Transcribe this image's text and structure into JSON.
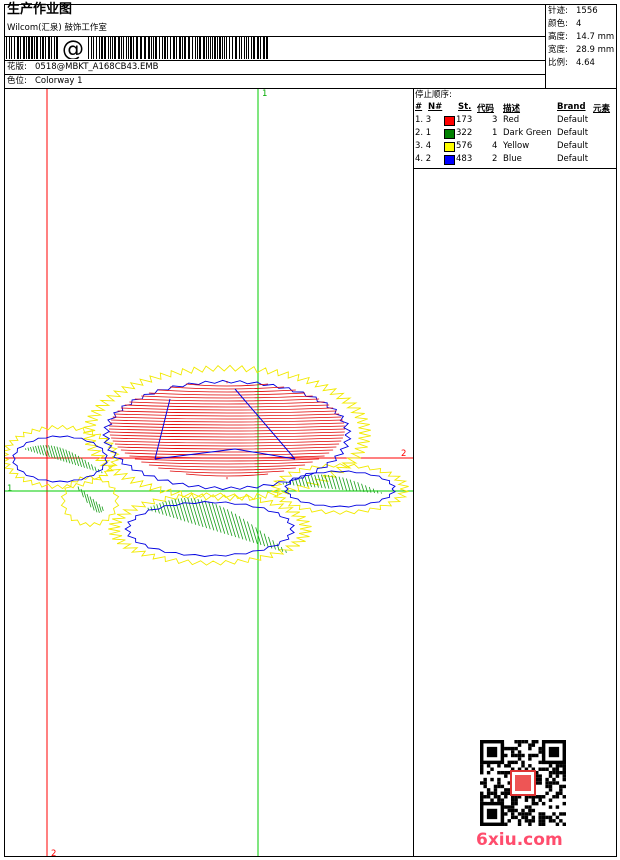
{
  "header": {
    "title": "生产作业图",
    "studio": "Wilcom(汇泉) 鼓饰工作室",
    "design_label": "花版:",
    "design_value": "0518@MBKT_A168CB43.EMB",
    "colorway_label": "色位:",
    "colorway_value": "Colorway 1"
  },
  "stats": {
    "stitches_label": "针迹:",
    "stitches_value": "1556",
    "colors_label": "颜色:",
    "colors_value": "4",
    "height_label": "高度:",
    "height_value": "14.7 mm",
    "width_label": "宽度:",
    "width_value": "28.9 mm",
    "ratio_label": "比例:",
    "ratio_value": "4.64"
  },
  "sequence": {
    "heading": "停止顺序:",
    "columns": [
      "#",
      "N#",
      "St.",
      "代码",
      "描述",
      "Brand",
      "元素"
    ],
    "rows": [
      {
        "n": "1. 3",
        "code_st": "173",
        "num": "3",
        "desc": "Red",
        "brand": "Default",
        "color": "#ff0000"
      },
      {
        "n": "2. 1",
        "code_st": "322",
        "num": "1",
        "desc": "Dark Green",
        "brand": "Default",
        "color": "#008000"
      },
      {
        "n": "3. 4",
        "code_st": "576",
        "num": "4",
        "desc": "Yellow",
        "brand": "Default",
        "color": "#ffff00"
      },
      {
        "n": "4. 2",
        "code_st": "483",
        "num": "2",
        "desc": "Blue",
        "brand": "Default",
        "color": "#0000ff"
      }
    ]
  },
  "guides": {
    "v1": "1",
    "v2": "2",
    "h1": "1",
    "h2": "2"
  },
  "watermark": "6xiu.com",
  "colors": {
    "guide_red": "#ff0000",
    "guide_green": "#00cc00"
  }
}
